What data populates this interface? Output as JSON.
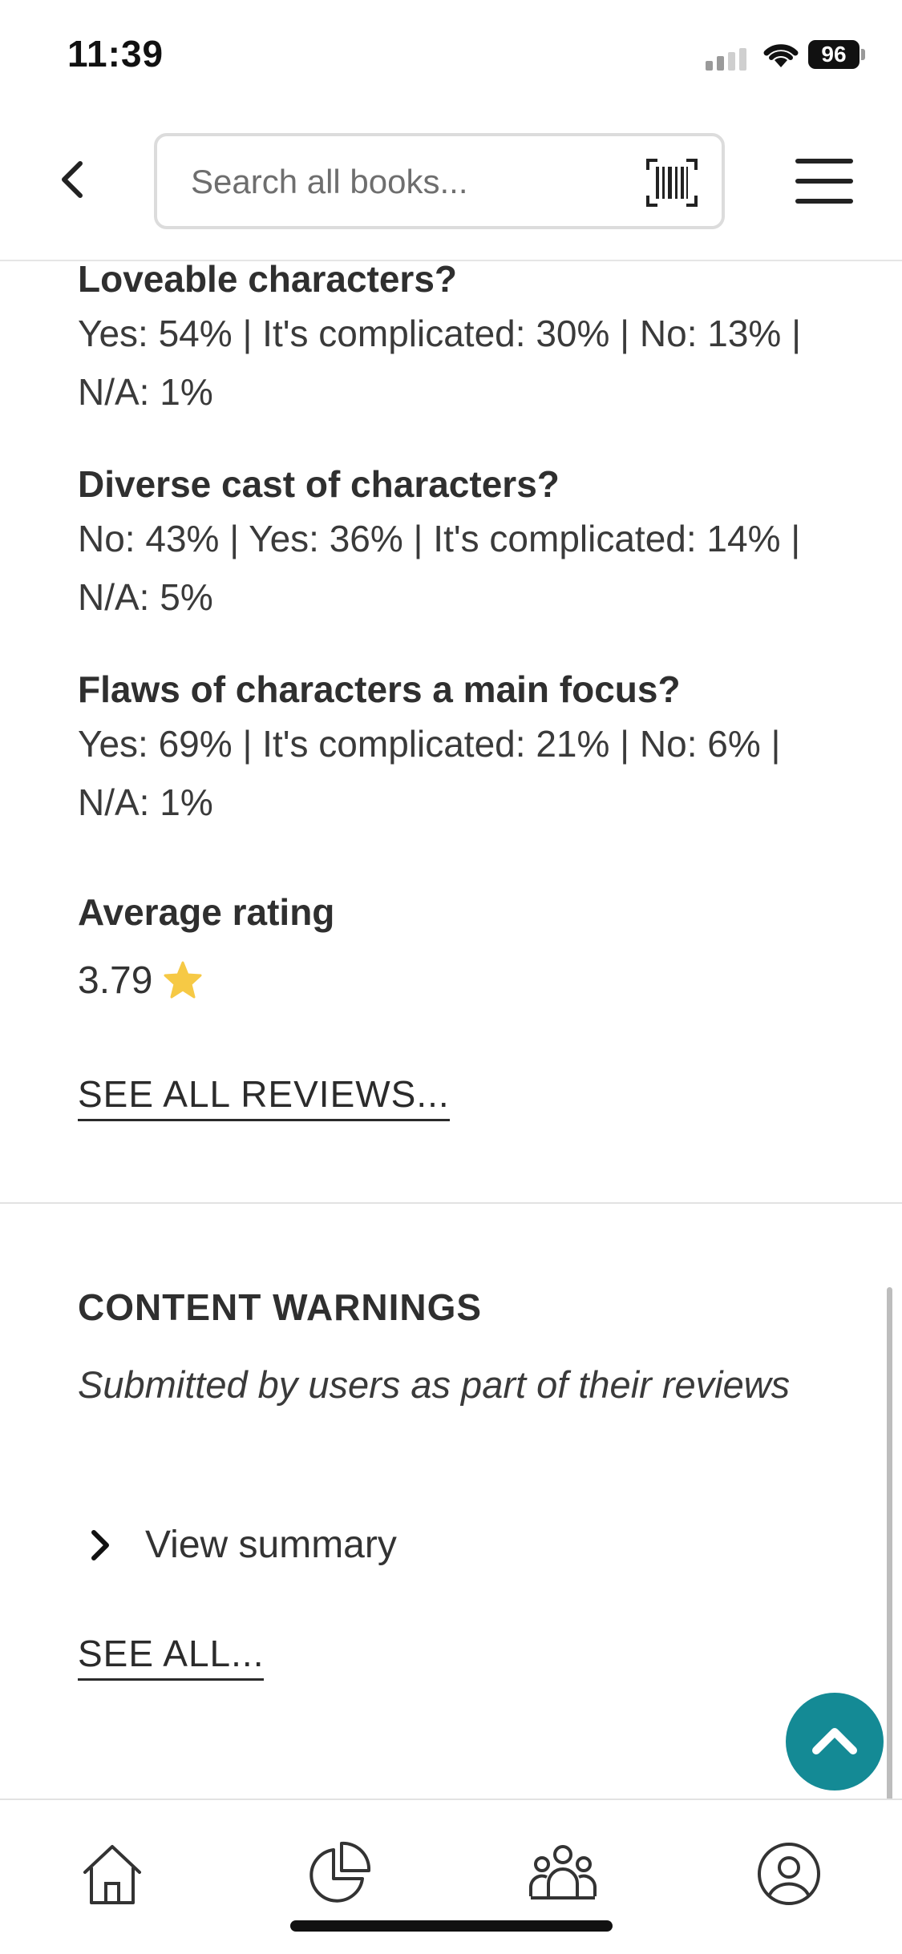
{
  "status_bar": {
    "time": "11:39",
    "battery": "96"
  },
  "header": {
    "search_placeholder": "Search all books..."
  },
  "questions": [
    {
      "title": "Loveable characters?",
      "text": "Yes: 54% | It's complicated: 30% | No: 13% | N/A: 1%"
    },
    {
      "title": "Diverse cast of characters?",
      "text": "No: 43% | Yes: 36% | It's complicated: 14% | N/A: 5%"
    },
    {
      "title": "Flaws of characters a main focus?",
      "text": "Yes: 69% | It's complicated: 21% | No: 6% | N/A: 1%"
    }
  ],
  "rating": {
    "label": "Average rating",
    "value": "3.79"
  },
  "reviews_link": "SEE ALL REVIEWS...",
  "content_warnings": {
    "title": "CONTENT WARNINGS",
    "subtitle": "Submitted by users as part of their reviews",
    "summary_label": "View summary",
    "see_all": "SEE ALL..."
  },
  "colors": {
    "accent": "#148a95",
    "star": "#f6c945"
  },
  "icons": [
    "back-icon",
    "barcode-icon",
    "menu-icon",
    "star-icon",
    "chevron-right-icon",
    "chevron-up-icon",
    "home-icon",
    "stats-icon",
    "community-icon",
    "profile-icon"
  ]
}
